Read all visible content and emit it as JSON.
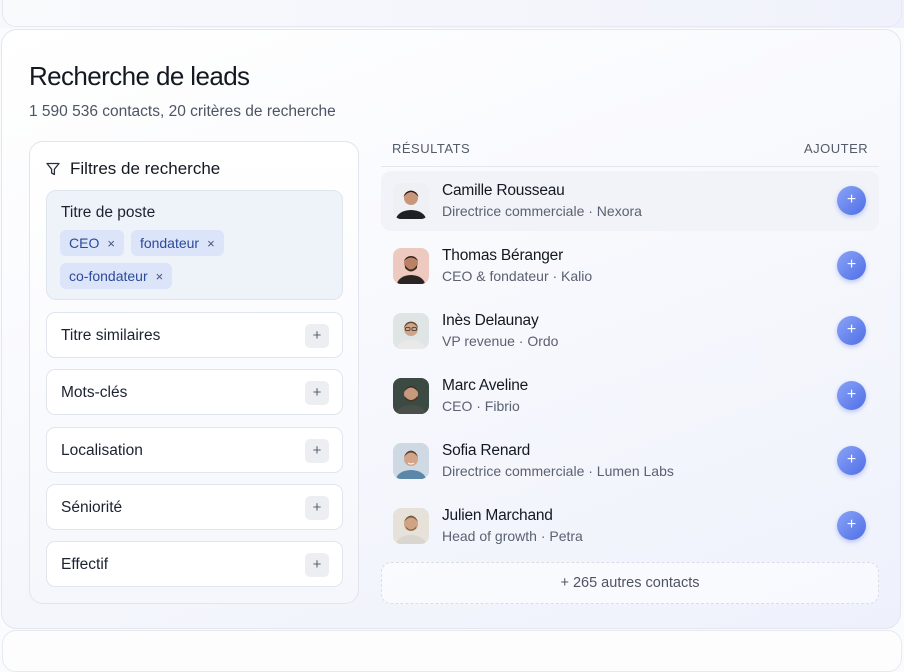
{
  "page": {
    "title": "Recherche de leads",
    "subtitle": "1 590 536 contacts, 20 critères de recherche"
  },
  "filters": {
    "header": "Filtres de recherche",
    "header_icon": "filter-icon",
    "job_title": {
      "label": "Titre de poste",
      "chips": [
        "CEO",
        "fondateur",
        "co-fondateur"
      ],
      "chip_remove": "×"
    },
    "rows": [
      {
        "label": "Titre similaires",
        "action": "+"
      },
      {
        "label": "Mots-clés",
        "action": "+"
      },
      {
        "label": "Localisation",
        "action": "+"
      },
      {
        "label": "Séniorité",
        "action": "+"
      },
      {
        "label": "Effectif",
        "action": "+"
      }
    ]
  },
  "results": {
    "header": "RÉSULTATS",
    "add_header": "AJOUTER",
    "add_symbol": "+",
    "items": [
      {
        "name": "Camille Rousseau",
        "subtitle": "Directrice commerciale · Nexora",
        "selected": true
      },
      {
        "name": "Thomas Béranger",
        "subtitle": "CEO & fondateur · Kalio",
        "selected": false
      },
      {
        "name": "Inès Delaunay",
        "subtitle": "VP revenue · Ordo",
        "selected": false
      },
      {
        "name": "Marc Aveline",
        "subtitle": "CEO · Fibrio",
        "selected": false
      },
      {
        "name": "Sofia Renard",
        "subtitle": "Directrice commerciale · Lumen Labs",
        "selected": false
      },
      {
        "name": "Julien Marchand",
        "subtitle": "Head of growth · Petra",
        "selected": false
      }
    ],
    "more": "+ 265 autres contacts"
  },
  "colors": {
    "accent": "#5b78ea",
    "chip_bg": "#dbe4f8",
    "chip_text": "#2d4a9a"
  }
}
